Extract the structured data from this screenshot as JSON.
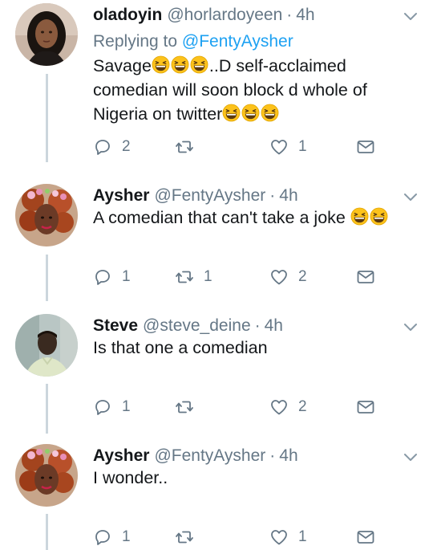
{
  "tweets": [
    {
      "name": "oladoyin",
      "handle": "@horlardoyeen",
      "dot": "·",
      "time": "4h",
      "reply_prefix": "Replying to",
      "reply_to": "@FentyAysher",
      "text_lines": [
        {
          "text": "Savage",
          "emoji_after": 3,
          "rest": "..D self-acclaimed"
        },
        {
          "text": "comedian will soon block d whole of",
          "emoji_after": 0,
          "rest": ""
        },
        {
          "text": "Nigeria on twitter",
          "emoji_after": 3,
          "rest": ""
        }
      ],
      "replies": "2",
      "retweets": "",
      "likes": "1"
    },
    {
      "name": "Aysher",
      "handle": "@FentyAysher",
      "dot": "·",
      "time": "4h",
      "text_lines": [
        {
          "text": "A comedian that can't take a joke ",
          "emoji_after": 2,
          "rest": ""
        }
      ],
      "replies": "1",
      "retweets": "1",
      "likes": "2"
    },
    {
      "name": "Steve",
      "handle": "@steve_deine",
      "dot": "·",
      "time": "4h",
      "text_lines": [
        {
          "text": "Is that one a comedian",
          "emoji_after": 0,
          "rest": ""
        }
      ],
      "replies": "1",
      "retweets": "",
      "likes": "2"
    },
    {
      "name": "Aysher",
      "handle": "@FentyAysher",
      "dot": "·",
      "time": "4h",
      "text_lines": [
        {
          "text": "I wonder..",
          "emoji_after": 0,
          "rest": ""
        }
      ],
      "replies": "1",
      "retweets": "",
      "likes": "1"
    }
  ],
  "icons": {
    "reply": "reply-icon",
    "retweet": "retweet-icon",
    "like": "heart-icon",
    "dm": "envelope-icon",
    "menu": "chevron-down-icon",
    "emoji": "grinning-squinting-face-emoji"
  },
  "colors": {
    "text": "#14171a",
    "secondary": "#657786",
    "link": "#1da1f2",
    "thread_line": "#ccd6dd",
    "emoji": "#fcc21b"
  }
}
